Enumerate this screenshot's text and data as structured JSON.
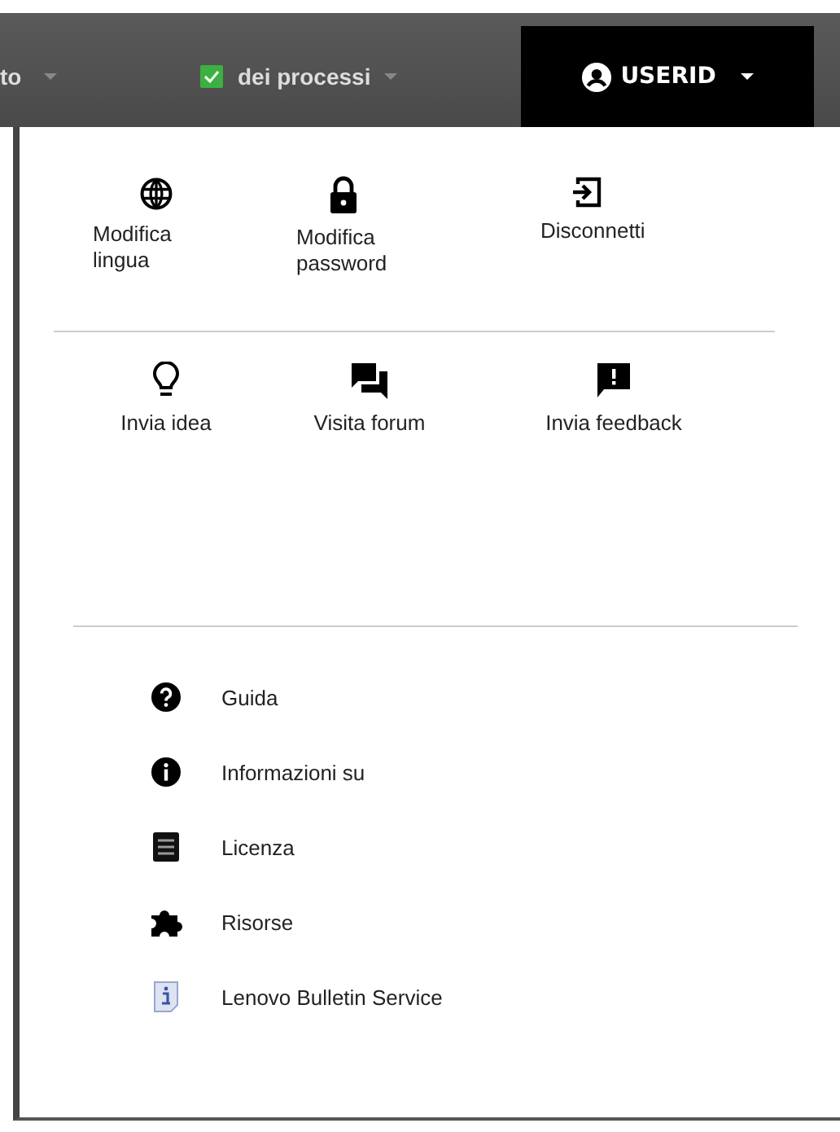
{
  "navbar": {
    "items": [
      {
        "label": "to",
        "kind": "plain",
        "selected": false
      },
      {
        "label": "dei processi",
        "kind": "check",
        "selected": false
      },
      {
        "label": "USERID",
        "kind": "user",
        "selected": true
      }
    ]
  },
  "menu": {
    "top_actions": [
      {
        "label": "Modifica lingua"
      },
      {
        "label": "Modifica password"
      },
      {
        "label": "Disconnetti"
      }
    ],
    "middle_actions": [
      {
        "label": "Invia idea"
      },
      {
        "label": "Visita forum"
      },
      {
        "label": "Invia feedback"
      }
    ],
    "links": [
      {
        "label": "Guida"
      },
      {
        "label": "Informazioni su"
      },
      {
        "label": "Licenza"
      },
      {
        "label": "Risorse"
      },
      {
        "label": "Lenovo Bulletin Service"
      }
    ]
  }
}
